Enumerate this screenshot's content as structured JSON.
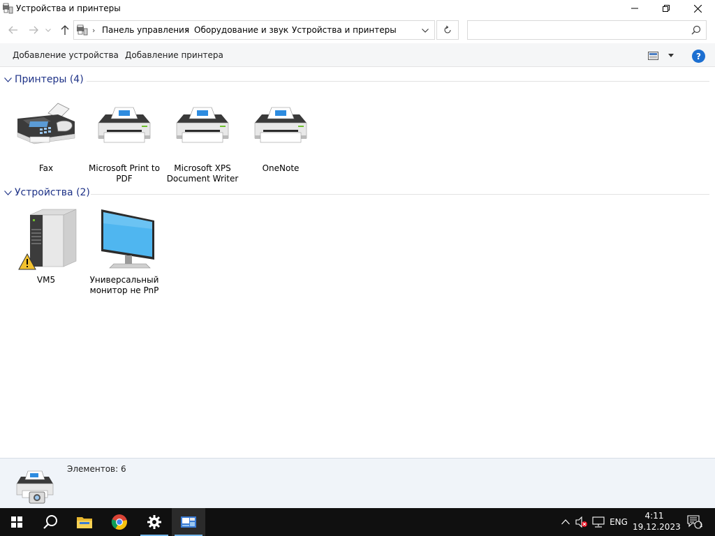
{
  "window": {
    "title": "Устройства и принтеры"
  },
  "address": {
    "breadcrumbs": [
      "Панель управления",
      "Оборудование и звук",
      "Устройства и принтеры"
    ],
    "search_placeholder": ""
  },
  "commands": {
    "add_device": "Добавление устройства",
    "add_printer": "Добавление принтера",
    "help": "?"
  },
  "groups": {
    "printers": {
      "title": "Принтеры (4)",
      "items": [
        {
          "label": "Fax",
          "icon": "fax-icon"
        },
        {
          "label": "Microsoft Print to PDF",
          "icon": "printer-icon"
        },
        {
          "label": "Microsoft XPS Document Writer",
          "icon": "printer-icon"
        },
        {
          "label": "OneNote",
          "icon": "printer-icon"
        }
      ]
    },
    "devices": {
      "title": "Устройства (2)",
      "items": [
        {
          "label": "VM5",
          "icon": "computer-warning-icon"
        },
        {
          "label": "Универсальный монитор не PnP",
          "icon": "monitor-icon"
        }
      ]
    }
  },
  "details": {
    "text": "Элементов: 6"
  },
  "taskbar": {
    "apps": [
      "start-icon",
      "search-icon",
      "file-explorer-icon",
      "chrome-icon",
      "settings-icon",
      "devices-printers-icon"
    ],
    "language": "ENG",
    "time": "4:11",
    "date": "19.12.2023",
    "notification_count": "1"
  }
}
